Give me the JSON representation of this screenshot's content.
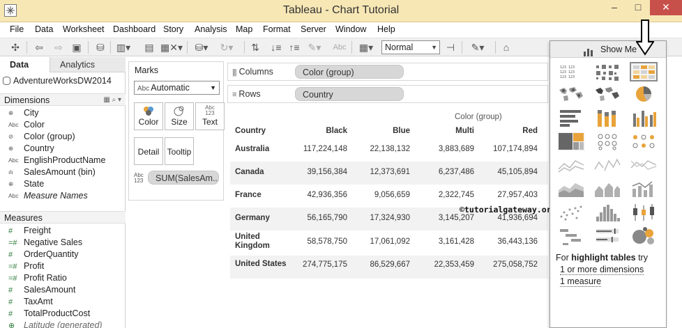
{
  "window": {
    "title": "Tableau - Chart Tutorial",
    "min_glyph": "–",
    "max_glyph": "□",
    "close_glyph": "✕"
  },
  "menu": [
    "File",
    "Data",
    "Worksheet",
    "Dashboard",
    "Story",
    "Analysis",
    "Map",
    "Format",
    "Server",
    "Window",
    "Help"
  ],
  "toolbar": {
    "fit_value": "Normal",
    "abc_glyph": "Abc"
  },
  "data_pane": {
    "tabs": [
      "Data",
      "Analytics"
    ],
    "datasource": "AdventureWorksDW2014",
    "dimensions_label": "Dimensions",
    "dimensions": [
      {
        "icon": "globe-icon",
        "glyph": "⊕",
        "label": "City"
      },
      {
        "icon": "abc-icon",
        "glyph": "Abc",
        "label": "Color"
      },
      {
        "icon": "paperclip-icon",
        "glyph": "⊘",
        "label": "Color (group)"
      },
      {
        "icon": "globe-icon",
        "glyph": "⊕",
        "label": "Country"
      },
      {
        "icon": "abc-icon",
        "glyph": "Abc",
        "label": "EnglishProductName"
      },
      {
        "icon": "bin-icon",
        "glyph": "ılı",
        "label": "SalesAmount (bin)"
      },
      {
        "icon": "globe-icon",
        "glyph": "⊕",
        "label": "State"
      },
      {
        "icon": "abc-icon",
        "glyph": "Abc",
        "label": "Measure Names"
      }
    ],
    "measures_label": "Measures",
    "measures": [
      {
        "icon": "number-icon",
        "glyph": "#",
        "label": "Freight"
      },
      {
        "icon": "calc-number-icon",
        "glyph": "=#",
        "label": "Negative Sales"
      },
      {
        "icon": "number-icon",
        "glyph": "#",
        "label": "OrderQuantity"
      },
      {
        "icon": "calc-number-icon",
        "glyph": "=#",
        "label": "Profit"
      },
      {
        "icon": "calc-number-icon",
        "glyph": "=#",
        "label": "Profit Ratio"
      },
      {
        "icon": "number-icon",
        "glyph": "#",
        "label": "SalesAmount"
      },
      {
        "icon": "number-icon",
        "glyph": "#",
        "label": "TaxAmt"
      },
      {
        "icon": "number-icon",
        "glyph": "#",
        "label": "TotalProductCost"
      },
      {
        "icon": "globe-icon",
        "glyph": "⊕",
        "label": "Latitude (generated)"
      }
    ]
  },
  "marks": {
    "header": "Marks",
    "type_abc": "Abc",
    "type": "Automatic",
    "buttons": [
      "Color",
      "Size",
      "Text",
      "Detail",
      "Tooltip"
    ],
    "text_glyph_top": "Abc",
    "text_glyph_bottom": "123",
    "sum_glyph_top": "Abc",
    "sum_glyph_bottom": "123",
    "sum_pill": "SUM(SalesAm.."
  },
  "shelves": {
    "columns_label": "Columns",
    "columns_pill": "Color (group)",
    "rows_label": "Rows",
    "rows_pill": "Country"
  },
  "table": {
    "column_group": "Color (group)",
    "row_header": "Country",
    "columns": [
      "Black",
      "Blue",
      "Multi",
      "Red"
    ],
    "rows": [
      {
        "country": "Australia",
        "values": [
          "117,224,148",
          "22,138,132",
          "3,883,689",
          "107,174,894"
        ]
      },
      {
        "country": "Canada",
        "values": [
          "39,156,384",
          "12,373,691",
          "6,237,486",
          "45,105,894"
        ]
      },
      {
        "country": "France",
        "values": [
          "42,936,356",
          "9,056,659",
          "2,322,745",
          "27,957,403"
        ]
      },
      {
        "country": "Germany",
        "values": [
          "56,165,790",
          "17,324,930",
          "3,145,207",
          "41,936,694"
        ]
      },
      {
        "country_line1": "United",
        "country_line2": "Kingdom",
        "values": [
          "58,578,750",
          "17,061,092",
          "3,161,428",
          "36,443,136"
        ]
      },
      {
        "country": "United States",
        "values": [
          "274,775,175",
          "86,529,667",
          "22,353,459",
          "275,058,752"
        ]
      }
    ]
  },
  "show_me": {
    "title": "Show Me",
    "hint_prefix": "For ",
    "hint_chart": "highlight tables",
    "hint_suffix": " try",
    "req1": "1 or more dimensions",
    "req2": "1 measure"
  },
  "watermark": "©tutorialgateway.org",
  "colors": {
    "titlebar": "#f7e7b5",
    "close": "#c7504b",
    "accent_orange": "#e8a33a",
    "highlight_green": "#3c8d4b"
  }
}
